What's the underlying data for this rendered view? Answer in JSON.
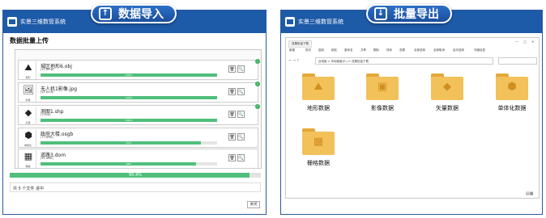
{
  "import_badge": {
    "label": "数据导入",
    "icon": "upload-icon"
  },
  "export_badge": {
    "label": "批量导出",
    "icon": "download-icon"
  },
  "left_window": {
    "app_title": "实景三维数管系统",
    "section_title": "数据批量上传",
    "files": [
      {
        "name": "城区地形6.obj",
        "size": "(41.8mB)",
        "percent_label": "100%",
        "progress": 1.0,
        "icon": "terrain-icon",
        "icon_tag": "地形",
        "done": true
      },
      {
        "name": "无人机1影像.jpg",
        "size": "(41.8mB)",
        "percent_label": "100%",
        "progress": 1.0,
        "icon": "image-icon",
        "icon_tag": "影像",
        "done": true
      },
      {
        "name": "测图1.shp",
        "size": "(12MB)",
        "percent_label": "100%",
        "progress": 1.0,
        "icon": "vector-icon",
        "icon_tag": "矢量",
        "done": true
      },
      {
        "name": "政府大楼.osgb",
        "size": "(77.8MB)",
        "percent_label": "91%",
        "progress": 0.91,
        "icon": "cube-icon",
        "icon_tag": "单体化",
        "done": false
      },
      {
        "name": "道路3.dom",
        "size": "(41.8MB)",
        "percent_label": "88%",
        "progress": 0.88,
        "icon": "grid-icon",
        "icon_tag": "栅格",
        "done": false
      }
    ],
    "delete_glyph": "🗑",
    "view_glyph": "🔍",
    "check_glyph": "✓",
    "total_progress": 0.954,
    "total_percent_label": "95.4%",
    "status_text": "共 5 个文件 进中",
    "close_label": "关闭"
  },
  "right_window": {
    "app_title": "实景三维数管系统",
    "tab_label": "成果批量下载",
    "win_controls": [
      "—",
      "□",
      "✕"
    ],
    "toolbar": [
      "新建",
      "剪切",
      "复制",
      "粘贴",
      "重命名",
      "共享",
      "删除",
      "排序",
      "查看",
      "全部选择",
      "全部取消",
      "反向选择",
      "详细信息"
    ],
    "address": [
      "此电脑",
      "本地磁盘(E:)",
      "成果批量下载"
    ],
    "search_placeholder": "",
    "folders": [
      {
        "label": "地形数据",
        "icon": "terrain-icon"
      },
      {
        "label": "影像数据",
        "icon": "image-icon"
      },
      {
        "label": "矢量数据",
        "icon": "vector-icon"
      },
      {
        "label": "单体化数据",
        "icon": "cube-icon"
      },
      {
        "label": "栅格数据",
        "icon": "grid-icon"
      }
    ],
    "colors": {
      "folder": "#f2c15a",
      "folder_tab": "#e4a83b",
      "accent": "#1d5aa8",
      "progress": "#4fbf7b"
    }
  }
}
